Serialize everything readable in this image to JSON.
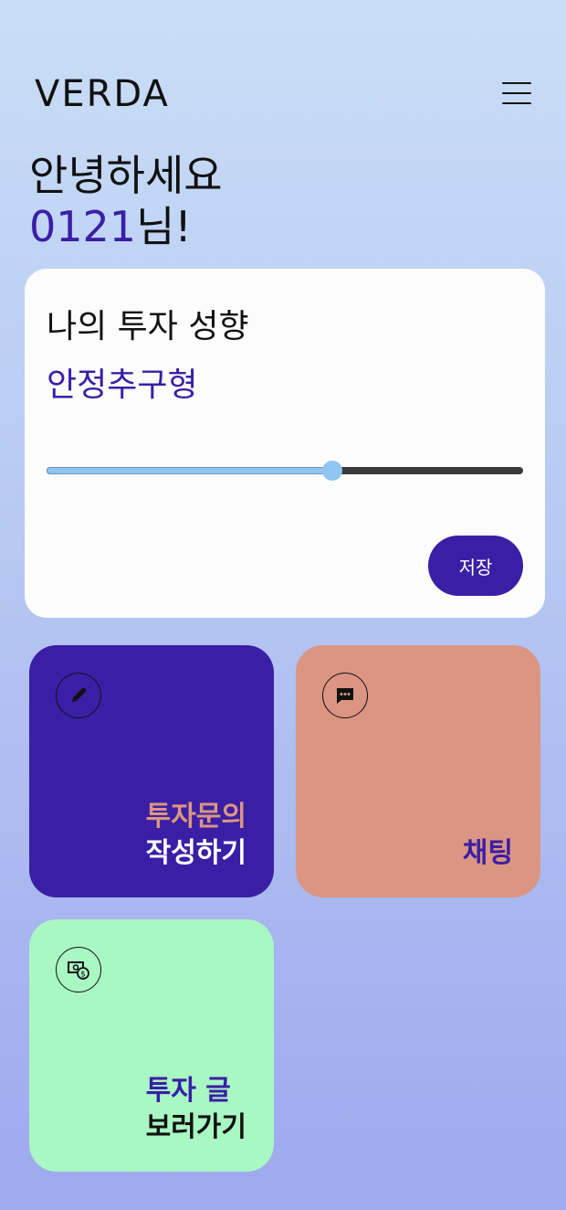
{
  "header": {
    "brand": "VERDA"
  },
  "greeting": {
    "line1": "안녕하세요",
    "username": "0121",
    "suffix": "님!"
  },
  "preference": {
    "title": "나의 투자 성향",
    "type": "안정추구형",
    "slider_value": 0.6,
    "save_label": "저장"
  },
  "tiles": [
    {
      "line1": "투자문의",
      "line2": "작성하기",
      "icon": "pencil-icon",
      "bg": "#3a1fa6",
      "line1_color": "#db9582",
      "line2_color": "#ffffff"
    },
    {
      "line1": "",
      "line2": "채팅",
      "icon": "chat-bubble-icon",
      "bg": "#db9582",
      "line1_color": "#3a1fa6",
      "line2_color": "#3a1fa6"
    },
    {
      "line1": "투자 글",
      "line2": "보러가기",
      "icon": "money-icon",
      "bg": "#a9f7c3",
      "line1_color": "#3a1fa6",
      "line2_color": "#111111"
    }
  ],
  "colors": {
    "accent": "#3a1fa6",
    "slider_fill": "#8fc6f1",
    "card_bg": "#fcfcfc"
  }
}
